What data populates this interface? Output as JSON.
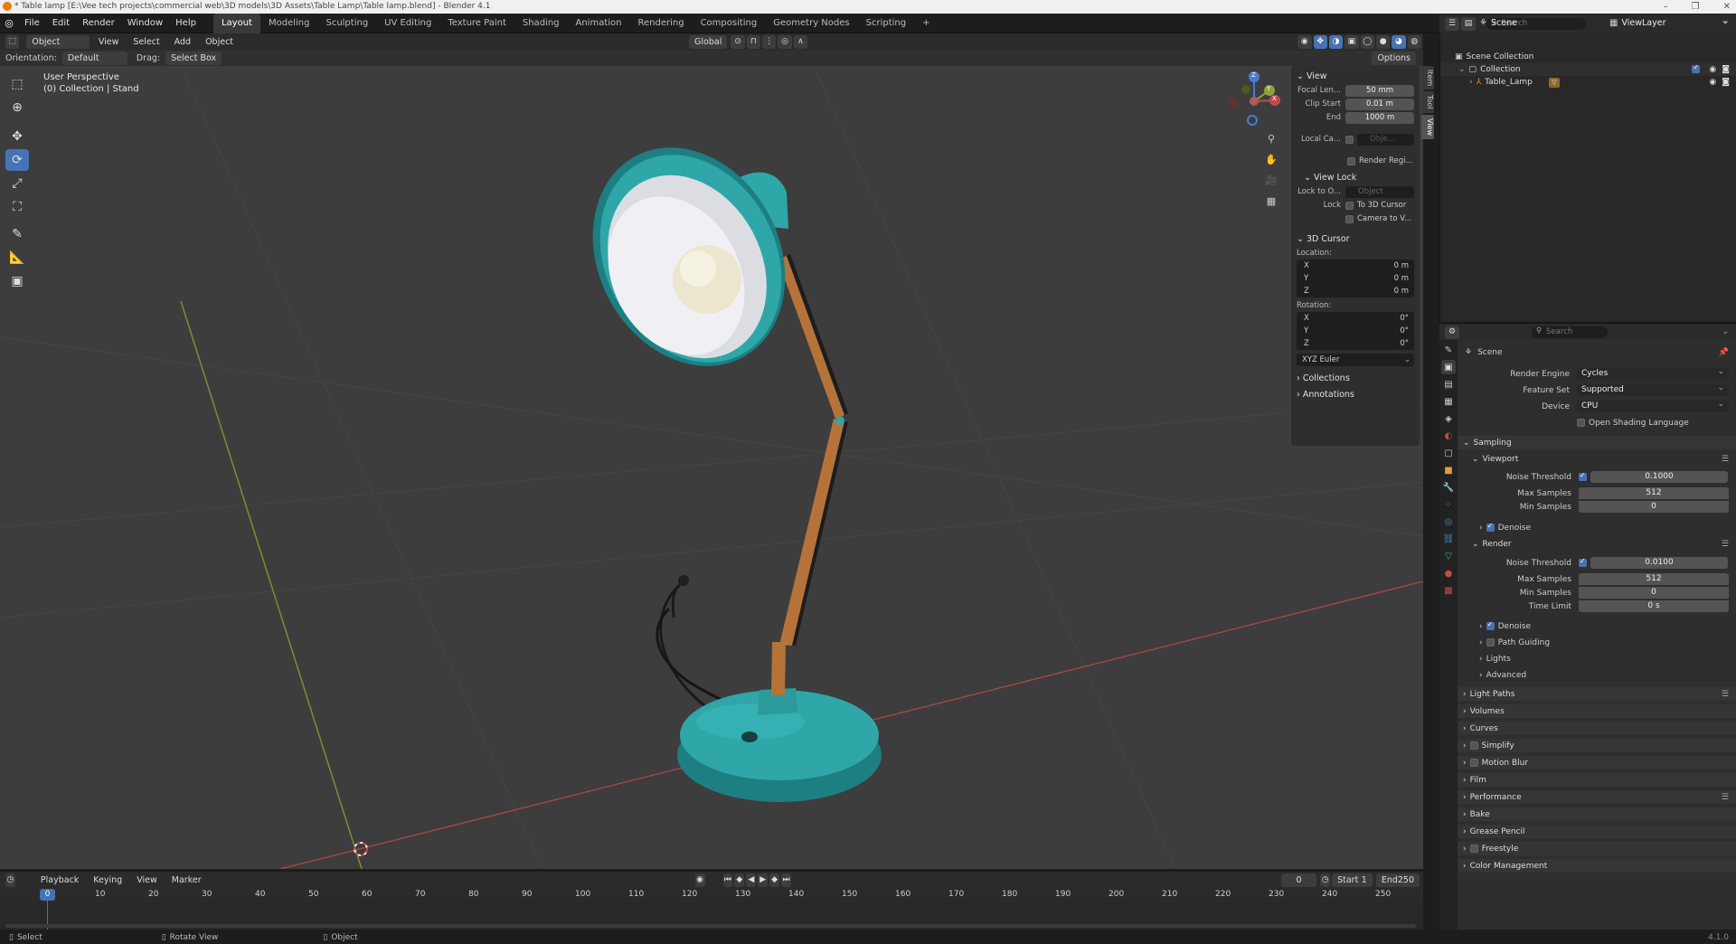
{
  "window": {
    "title": "* Table lamp [E:\\Vee tech projects\\commercial web\\3D models\\3D Assets\\Table Lamp\\Table lamp.blend] - Blender 4.1",
    "controls": [
      "–",
      "❐",
      "✕"
    ]
  },
  "menu": [
    "File",
    "Edit",
    "Render",
    "Window",
    "Help"
  ],
  "workspaces": [
    "Layout",
    "Modeling",
    "Sculpting",
    "UV Editing",
    "Texture Paint",
    "Shading",
    "Animation",
    "Rendering",
    "Compositing",
    "Geometry Nodes",
    "Scripting"
  ],
  "active_workspace": "Layout",
  "scene_field": "Scene",
  "viewlayer_field": "ViewLayer",
  "viewport_header": {
    "mode": "Object Mode",
    "menus": [
      "View",
      "Select",
      "Add",
      "Object"
    ],
    "transform": "Global",
    "options": "Options",
    "search_placeholder": "Search"
  },
  "viewport_subheader": {
    "orientation_label": "Orientation:",
    "orientation_value": "Default",
    "drag_label": "Drag:",
    "drag_value": "Select Box"
  },
  "viewport_info": {
    "line1": "User Perspective",
    "line2": "(0) Collection | Stand"
  },
  "gizmo": {
    "x": "X",
    "y": "Y",
    "z": "Z"
  },
  "npanel": {
    "tabs": [
      "Item",
      "Tool",
      "View"
    ],
    "view_header": "View",
    "focal_label": "Focal Len...",
    "focal_value": "50 mm",
    "clip_start_label": "Clip Start",
    "clip_start_value": "0.01 m",
    "end_label": "End",
    "end_value": "1000 m",
    "local_cam_label": "Local Ca...",
    "local_cam_placeholder": "Obje...",
    "render_region": "Render Regi...",
    "view_lock_header": "View Lock",
    "lock_to_label": "Lock to O...",
    "lock_to_placeholder": "Object",
    "lock_label": "Lock",
    "lock_3d_cursor": "To 3D Cursor",
    "lock_camera": "Camera to V...",
    "cursor_header": "3D Cursor",
    "location_label": "Location:",
    "loc": [
      {
        "axis": "X",
        "val": "0 m"
      },
      {
        "axis": "Y",
        "val": "0 m"
      },
      {
        "axis": "Z",
        "val": "0 m"
      }
    ],
    "rotation_label": "Rotation:",
    "rot": [
      {
        "axis": "X",
        "val": "0°"
      },
      {
        "axis": "Y",
        "val": "0°"
      },
      {
        "axis": "Z",
        "val": "0°"
      }
    ],
    "rotation_mode": "XYZ Euler",
    "collections": "Collections",
    "annotations": "Annotations"
  },
  "timeline": {
    "menus": [
      "Playback",
      "Keying",
      "View",
      "Marker"
    ],
    "current_frame": "0",
    "start_label": "Start",
    "start_value": "1",
    "end_label": "End",
    "end_value": "250",
    "ticks": [
      "0",
      "10",
      "20",
      "30",
      "40",
      "50",
      "60",
      "70",
      "80",
      "90",
      "100",
      "110",
      "120",
      "130",
      "140",
      "150",
      "160",
      "170",
      "180",
      "190",
      "200",
      "210",
      "220",
      "230",
      "240",
      "250"
    ]
  },
  "statusbar": {
    "select": "Select",
    "rotate": "Rotate View",
    "object": "Object",
    "version": "4.1.0"
  },
  "outliner": {
    "search_placeholder": "Search",
    "scene_collection": "Scene Collection",
    "collection": "Collection",
    "object": "Table_Lamp"
  },
  "properties": {
    "search_placeholder": "Search",
    "context": "Scene",
    "render_engine_label": "Render Engine",
    "render_engine": "Cycles",
    "feature_set_label": "Feature Set",
    "feature_set": "Supported",
    "device_label": "Device",
    "device": "CPU",
    "osl": "Open Shading Language",
    "sampling": "Sampling",
    "viewport": "Viewport",
    "noise_threshold_label": "Noise Threshold",
    "vp_noise": "0.1000",
    "max_samples_label": "Max Samples",
    "vp_max": "512",
    "min_samples_label": "Min Samples",
    "vp_min": "0",
    "denoise": "Denoise",
    "render": "Render",
    "r_noise": "0.0100",
    "r_max": "512",
    "r_min": "0",
    "time_limit_label": "Time Limit",
    "r_time": "0 s",
    "path_guiding": "Path Guiding",
    "lights": "Lights",
    "advanced": "Advanced",
    "panels": [
      "Light Paths",
      "Volumes",
      "Curves",
      "Simplify",
      "Motion Blur",
      "Film",
      "Performance",
      "Bake",
      "Grease Pencil",
      "Freestyle",
      "Color Management"
    ]
  },
  "colors": {
    "accent": "#4772b3",
    "lamp_body": "#2fa6a8",
    "lamp_wood": "#b5733a",
    "x_axis": "#c44a4a",
    "y_axis": "#8aa33a"
  }
}
